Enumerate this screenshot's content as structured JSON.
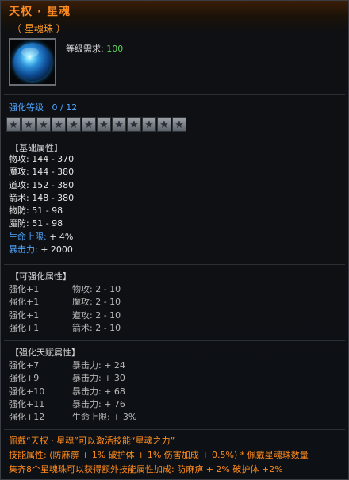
{
  "item": {
    "name": "天权 · 星魂",
    "type": "（ 星魂珠 ）",
    "icon": "star-soul-orb-icon",
    "level_req_label": "等级需求:",
    "level_req_value": "100"
  },
  "enhance": {
    "label": "强化等级",
    "value": "0 / 12",
    "stars_total": 12,
    "stars_filled": 0
  },
  "base": {
    "header": "【基础属性】",
    "stats": [
      {
        "label": "物攻:",
        "value": "144 - 370"
      },
      {
        "label": "魔攻:",
        "value": "144 - 380"
      },
      {
        "label": "道攻:",
        "value": "152 - 380"
      },
      {
        "label": "箭术:",
        "value": "148 - 380"
      },
      {
        "label": "物防:",
        "value": "51 - 98"
      },
      {
        "label": "魔防:",
        "value": "51 - 98"
      },
      {
        "label": "生命上限:",
        "value": "+ 4%"
      },
      {
        "label": "暴击力:",
        "value": "+ 2000"
      }
    ]
  },
  "enhanceable": {
    "header": "【可强化属性】",
    "rows": [
      {
        "level": "强化+1",
        "stat": "物攻: 2 - 10"
      },
      {
        "level": "强化+1",
        "stat": "魔攻: 2 - 10"
      },
      {
        "level": "强化+1",
        "stat": "道攻: 2 - 10"
      },
      {
        "level": "强化+1",
        "stat": "箭术: 2 - 10"
      }
    ]
  },
  "talent": {
    "header": "【强化天赋属性】",
    "rows": [
      {
        "level": "强化+7",
        "stat": "暴击力: + 24"
      },
      {
        "level": "强化+9",
        "stat": "暴击力: + 30"
      },
      {
        "level": "强化+10",
        "stat": "暴击力: + 68"
      },
      {
        "level": "强化+11",
        "stat": "暴击力: + 76"
      },
      {
        "level": "强化+12",
        "stat": "生命上限: + 3%"
      }
    ]
  },
  "description": {
    "line1": "佩戴“天权 · 星魂”可以激活技能“星魂之力”",
    "line2": "技能属性: (防麻痹 + 1%  破护体 + 1%  伤害加成 + 0.5%) * 佩戴星魂珠数量",
    "line3": "集齐8个星魂珠可以获得额外技能属性加成: 防麻痹 + 2% 破护体 +2%"
  },
  "colors": {
    "title": "#ff8a1e",
    "level_value": "#5bd35b",
    "highlight_blue": "#4fa6ff",
    "description": "#ff8c1e"
  }
}
